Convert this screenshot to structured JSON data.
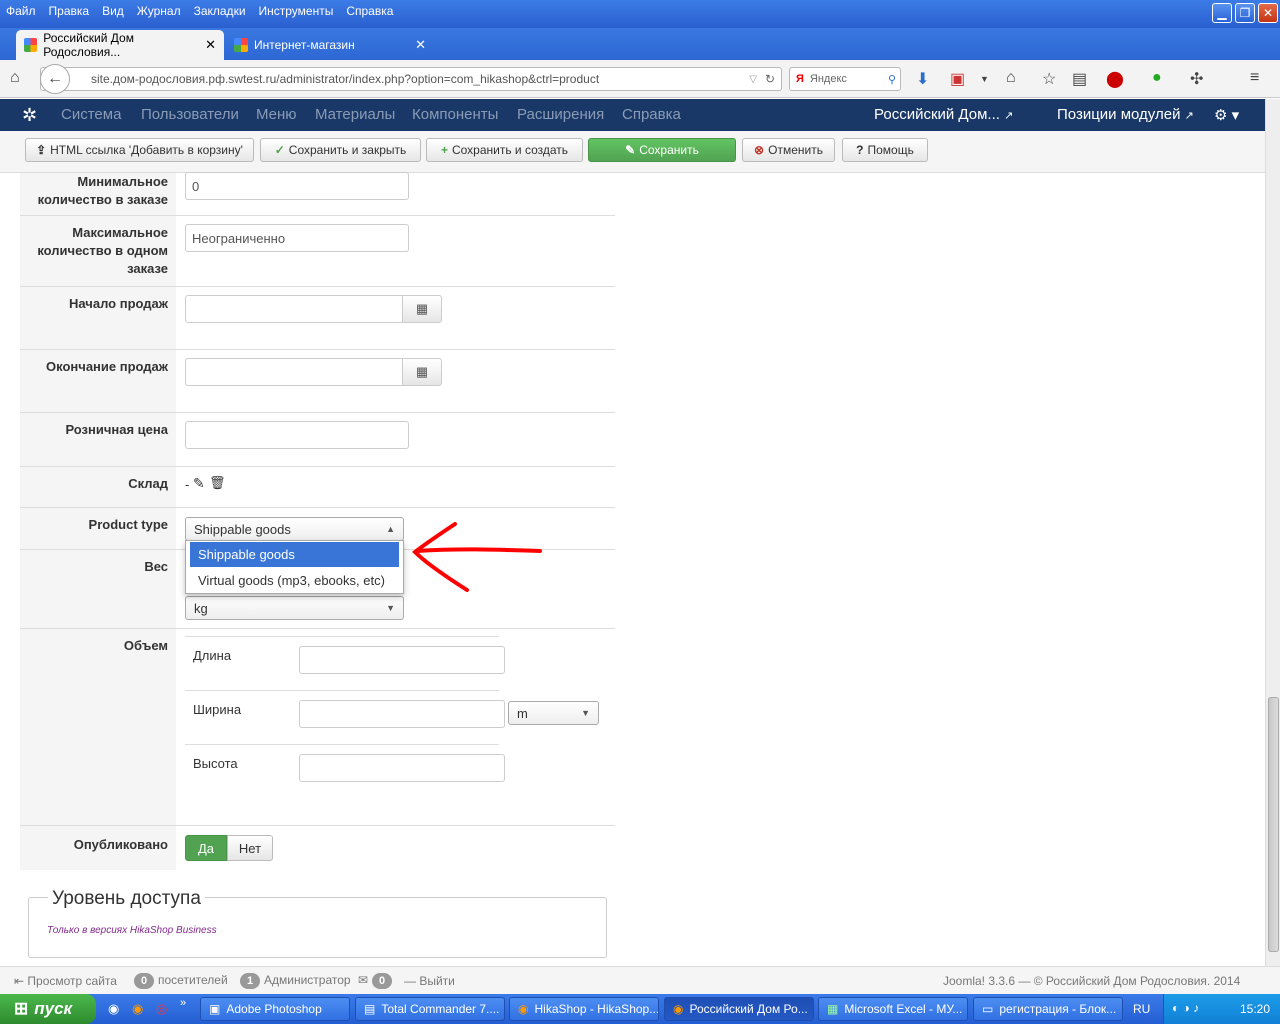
{
  "browser": {
    "menu": [
      "Файл",
      "Правка",
      "Вид",
      "Журнал",
      "Закладки",
      "Инструменты",
      "Справка"
    ],
    "tabs": [
      {
        "label": "Российский Дом Родословия..."
      },
      {
        "label": "Интернет-магазин"
      }
    ],
    "url": "site.дом-родословия.рф.swtest.ru/administrator/index.php?option=com_hikashop&ctrl=product",
    "search_placeholder": "Яндекс"
  },
  "admin_menu": {
    "items": [
      "Система",
      "Пользователи",
      "Меню",
      "Материалы",
      "Компоненты",
      "Расширения",
      "Справка"
    ],
    "site_link": "Российский Дом...",
    "modules_link": "Позиции модулей"
  },
  "toolbar": {
    "html_link": "HTML ссылка 'Добавить в корзину'",
    "save_close": "Сохранить и закрыть",
    "save_new": "Сохранить и создать",
    "save": "Сохранить",
    "cancel": "Отменить",
    "help": "Помощь"
  },
  "form": {
    "min_qty": {
      "label": "Минимальное количество в заказе",
      "value": "0"
    },
    "max_qty": {
      "label": "Максимальное количество в одном заказе",
      "value": "Неограниченно"
    },
    "sale_start": {
      "label": "Начало продаж",
      "value": ""
    },
    "sale_end": {
      "label": "Окончание продаж",
      "value": ""
    },
    "retail_price": {
      "label": "Розничная цена",
      "value": ""
    },
    "warehouse": {
      "label": "Склад",
      "value": "-"
    },
    "product_type": {
      "label": "Product type",
      "selected": "Shippable goods",
      "options": [
        "Shippable goods",
        "Virtual goods (mp3, ebooks, etc)"
      ]
    },
    "weight": {
      "label": "Вес",
      "unit": "kg"
    },
    "volume": {
      "label": "Объем",
      "length_label": "Длина",
      "width_label": "Ширина",
      "height_label": "Высота",
      "unit": "m"
    },
    "published": {
      "label": "Опубликовано",
      "yes": "Да",
      "no": "Нет",
      "selected": "Да"
    }
  },
  "access": {
    "legend": "Уровень доступа",
    "note": "Только в версиях HikaShop Business"
  },
  "status": {
    "view_site": "Просмотр сайта",
    "visitors_count": "0",
    "visitors": "посетителей",
    "admins_count": "1",
    "admins": "Администратор",
    "messages_count": "0",
    "logout": "Выйти",
    "copyright": "Joomla! 3.3.6 — © Российский Дом Родословия. 2014"
  },
  "taskbar": {
    "start": "пуск",
    "tasks": [
      "Adobe Photoshop",
      "Total Commander 7....",
      "HikaShop - HikaShop...",
      "Российский Дом Ро...",
      "Microsoft Excel - МУ...",
      "регистрация - Блок..."
    ],
    "lang": "RU",
    "clock": "15:20"
  },
  "colors": {
    "admin_bar": "#1a3867",
    "save_green": "#51a351",
    "highlight": "#3875d7",
    "annotation_arrow": "#ff0000"
  }
}
